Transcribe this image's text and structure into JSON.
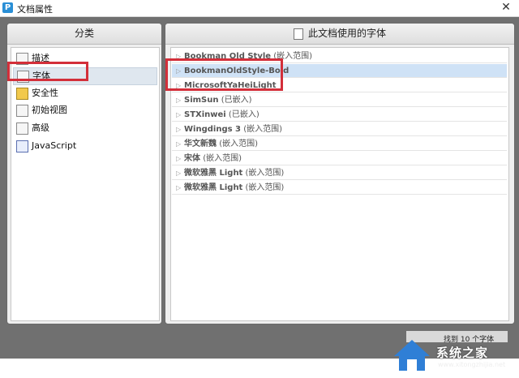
{
  "window": {
    "title": "文档属性",
    "app_icon_letter": "P",
    "close_glyph": "✕"
  },
  "left": {
    "header": "分类",
    "items": [
      {
        "label": "描述",
        "icon": "document-icon"
      },
      {
        "label": "字体",
        "icon": "font-icon",
        "selected": true
      },
      {
        "label": "安全性",
        "icon": "lock-icon"
      },
      {
        "label": "初始视图",
        "icon": "view-icon"
      },
      {
        "label": "高级",
        "icon": "advanced-icon"
      },
      {
        "label": "JavaScript",
        "icon": "javascript-icon"
      }
    ]
  },
  "right": {
    "header": "此文档使用的字体",
    "fonts": [
      {
        "name": "Bookman Old Style",
        "note": "(嵌入范围)"
      },
      {
        "name": "BookmanOldStyle-Bold",
        "note": "",
        "selected": true
      },
      {
        "name": "MicrosoftYaHeiLight",
        "note": ""
      },
      {
        "name": "SimSun",
        "note": "(已嵌入)"
      },
      {
        "name": "STXinwei",
        "note": "(已嵌入)"
      },
      {
        "name": "Wingdings 3",
        "note": "(嵌入范围)"
      },
      {
        "name": "华文新魏",
        "note": "(嵌入范围)"
      },
      {
        "name": "宋体",
        "note": "(嵌入范围)"
      },
      {
        "name": "微软雅黑 Light",
        "note": "(嵌入范围)"
      },
      {
        "name": "微软雅黑 Light",
        "note": "(嵌入范围)"
      }
    ],
    "count_text": "找到 10 个字体"
  },
  "watermark": {
    "text": "系统之家",
    "sub": "www.xitongzhijia.net"
  },
  "colors": {
    "highlight_red": "#d32f3a",
    "selection_blue": "#cfe2f6",
    "dialog_gray": "#707070"
  }
}
